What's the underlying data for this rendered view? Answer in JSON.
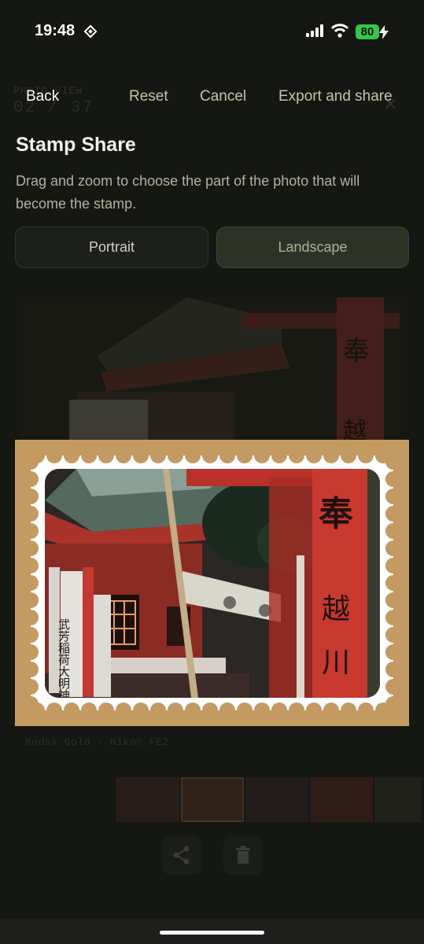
{
  "status": {
    "time": "19:48",
    "battery": "80",
    "location_icon": "location-diamond-icon",
    "signal_icon": "cellular-signal-icon",
    "wifi_icon": "wifi-icon"
  },
  "background": {
    "section_label": "PHOTO VIEW",
    "counter": "02 / 37",
    "caption": "Kodak Gold · Nikon FE2"
  },
  "toolbar": {
    "back": "Back",
    "reset": "Reset",
    "cancel": "Cancel",
    "export": "Export and share"
  },
  "sheet": {
    "title": "Stamp Share",
    "description": "Drag and zoom to choose the part of the photo that will become the stamp."
  },
  "orientation": {
    "options": [
      "Portrait",
      "Landscape"
    ],
    "selected": "Landscape"
  },
  "stamp": {
    "frame_color": "#c49a63",
    "perforation_color": "#ffffff"
  },
  "photo_signs": {
    "pillar_chars": [
      "奉",
      "越",
      "川"
    ],
    "banner_text": "武芳稲荷大明神"
  }
}
